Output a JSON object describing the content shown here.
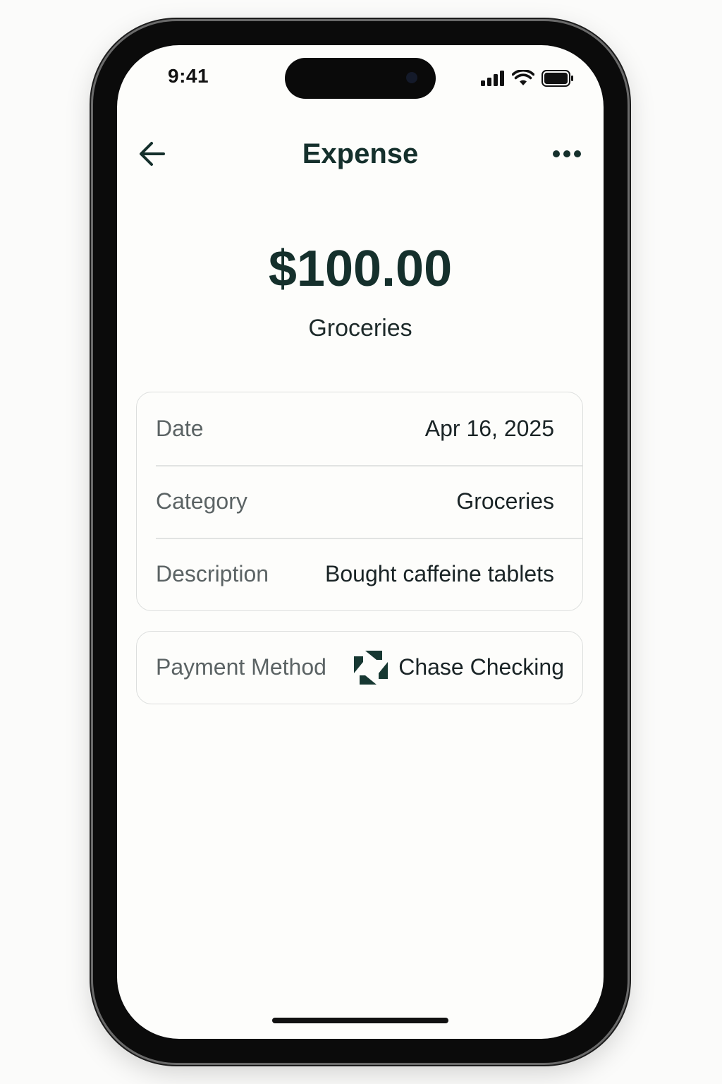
{
  "status_bar": {
    "time": "9:41"
  },
  "nav": {
    "title": "Expense",
    "back_icon": "arrow-left-icon",
    "more_icon": "more-horizontal-icon"
  },
  "summary": {
    "amount": "$100.00",
    "category": "Groceries"
  },
  "details": [
    {
      "label": "Date",
      "value": "Apr 16, 2025"
    },
    {
      "label": "Category",
      "value": "Groceries"
    },
    {
      "label": "Description",
      "value": "Bought caffeine tablets"
    }
  ],
  "payment": {
    "label": "Payment Method",
    "value": "Chase Checking",
    "icon": "chase-logo-icon"
  },
  "colors": {
    "accent": "#15302c",
    "label": "#5b6364",
    "card_border": "#dcdedd"
  }
}
